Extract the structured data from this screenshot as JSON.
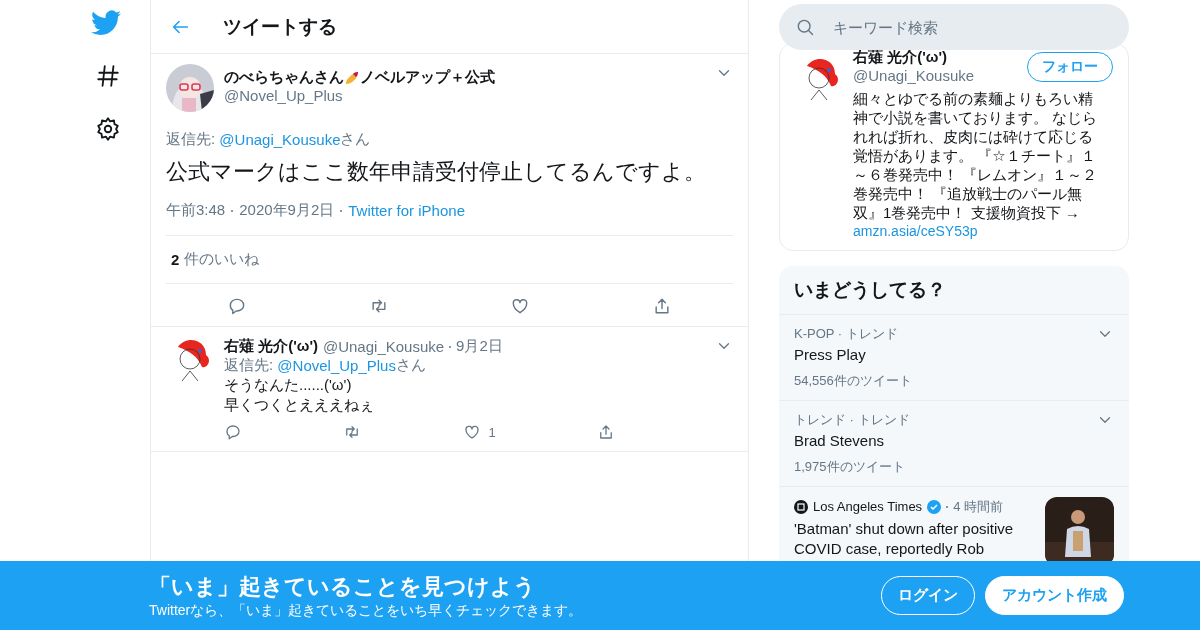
{
  "header": {
    "title": "ツイートする"
  },
  "main_tweet": {
    "name_before": "のべらちゃんさん",
    "name_after": "ノベルアップ＋公式",
    "handle": "@Novel_Up_Plus",
    "reply_label": "返信先:",
    "reply_to": "@Unagi_Kousuke",
    "reply_suffix": "さん",
    "text": "公式マークはここ数年申請受付停止してるんですよ。",
    "time": "午前3:48",
    "date": "2020年9月2日",
    "source": "Twitter for iPhone",
    "likes_count": "2",
    "likes_label": "件のいいね"
  },
  "replies": [
    {
      "name": "右薙 光介('ω')",
      "handle": "@Unagi_Kousuke",
      "date": "9月2日",
      "reply_label": "返信先:",
      "reply_to": "@Novel_Up_Plus",
      "reply_suffix": "さん",
      "lines": [
        "そうなんた......('ω')",
        "早くつくとえええねぇ"
      ],
      "like_count": "1"
    }
  ],
  "search": {
    "placeholder": "キーワード検索"
  },
  "profile": {
    "name": "右薙 光介('ω')",
    "handle": "@Unagi_Kousuke",
    "follow": "フォロー",
    "bio": "細々とゆでる前の素麺よりもろい精神で小説を書いております。 なじられれば折れ、皮肉には砕けて応じる覚悟があります。 『☆１チート』１～６巻発売中！ 『レムオン』１～２巻発売中！ 『追放戦士のパール無双』1巻発売中！ 支援物資投下 →",
    "link": "amzn.asia/ceSY53p"
  },
  "trends": {
    "title": "いまどうしてる？",
    "items": [
      {
        "kind": "trend",
        "context": "K-POP · トレンド",
        "name": "Press Play",
        "count": "54,556件のツイート"
      },
      {
        "kind": "trend",
        "context": "トレンド · トレンド",
        "name": "Brad Stevens",
        "count": "1,975件のツイート"
      },
      {
        "kind": "news",
        "source": "Los Angeles Times",
        "time": "4 時間前",
        "headline": "'Batman' shut down after positive COVID case, reportedly Rob"
      }
    ]
  },
  "banner": {
    "title": "「いま」起きていることを見つけよう",
    "subtitle": "Twitterなら、「いま」起きていることをいち早くチェックできます。",
    "login": "ログイン",
    "signup": "アカウント作成"
  }
}
